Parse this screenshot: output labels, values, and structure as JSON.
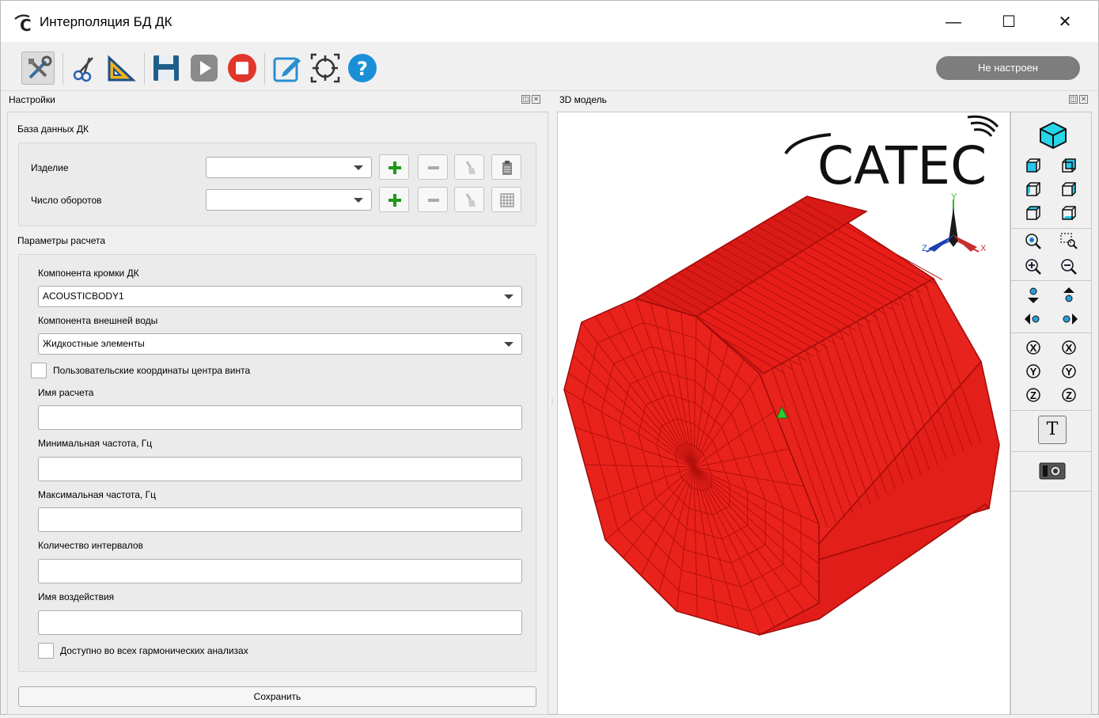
{
  "window": {
    "title": "Интерполяция БД ДК",
    "minimize_glyph": "—",
    "maximize_glyph": "☐",
    "close_glyph": "✕"
  },
  "toolbar": {
    "status": "Не настроен",
    "icons": [
      "tools-icon",
      "scissors-icon",
      "ruler-triangle-icon",
      "save-icon",
      "play-icon",
      "stop-icon",
      "edit-icon",
      "target-icon",
      "help-icon"
    ]
  },
  "settings_dock": {
    "title": "Настройки",
    "db_group": {
      "title": "База данных ДК",
      "product_label": "Изделие",
      "product_value": "",
      "rpm_label": "Число оборотов",
      "rpm_value": ""
    },
    "calc_group": {
      "title": "Параметры расчета",
      "edge_component_label": "Компонента кромки ДК",
      "edge_component_value": "ACOUSTICBODY1",
      "water_component_label": "Компонента внешней воды",
      "water_component_value": "Жидкостные элементы",
      "custom_coords_label": "Пользовательские координаты центра винта",
      "custom_coords_checked": false,
      "calc_name_label": "Имя расчета",
      "calc_name_value": "",
      "min_freq_label": "Минимальная частота, Гц",
      "min_freq_value": "",
      "max_freq_label": "Максимальная частота, Гц",
      "max_freq_value": "",
      "intervals_label": "Количество интервалов",
      "intervals_value": "",
      "load_name_label": "Имя воздействия",
      "load_name_value": "",
      "all_harmonic_label": "Доступно во всех гармонических анализах",
      "all_harmonic_checked": false
    },
    "save_label": "Сохранить"
  },
  "model_dock": {
    "title": "3D модель",
    "logo_text": "CATEC",
    "axes": {
      "x": "X",
      "y": "Y",
      "z": "Z"
    },
    "colors": {
      "mesh": "#e8201c",
      "mesh_lines": "#b80f0c",
      "marker": "#2ecc2e"
    }
  },
  "view_panel": {
    "text_button": "T"
  }
}
